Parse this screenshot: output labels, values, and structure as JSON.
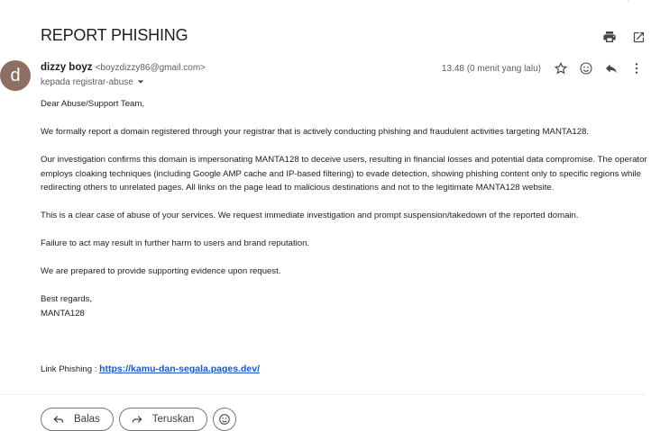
{
  "email": {
    "subject": "REPORT PHISHING",
    "sender": {
      "avatar_letter": "d",
      "name": "dizzy boyz",
      "email": "<boyzdizzy86@gmail.com>",
      "to": "kepada registrar-abuse"
    },
    "timestamp": "13.48 (0 menit yang lalu)",
    "body": [
      "Dear Abuse/Support Team,",
      "We formally report a domain registered through your registrar that is actively conducting phishing and fraudulent activities targeting MANTA128.",
      "Our investigation confirms this domain is impersonating MANTA128 to deceive users, resulting in financial losses and potential data compromise. The operator employs cloaking techniques (including Google AMP cache and IP-based filtering) to evade detection, showing phishing content only to specific regions while redirecting others to unrelated pages. All links on the page lead to malicious destinations and not to the legitimate MANTA128 website.",
      "This is a clear case of abuse of your services. We request immediate investigation and prompt suspension/takedown of the reported domain.",
      "Failure to act may result in further harm to users and brand reputation.",
      "We are prepared to provide supporting evidence upon request."
    ],
    "closing": "Best regards,",
    "signature": "MANTA128",
    "link_label": "Link Phishing : ",
    "link_url": "https://kamu-dan-segala.pages.dev/"
  },
  "actions": {
    "reply_label": "Balas",
    "forward_label": "Teruskan"
  },
  "icons": {
    "print": "print-icon",
    "open_new_window": "open-in-new-icon",
    "star": "star-icon",
    "emoji": "emoji-icon",
    "reply": "reply-icon",
    "more": "more-vert-icon",
    "dropdown": "chevron-down-icon",
    "forward": "forward-icon"
  },
  "colors": {
    "avatar_bg": "#8d6e63",
    "link": "#1a57c9"
  }
}
